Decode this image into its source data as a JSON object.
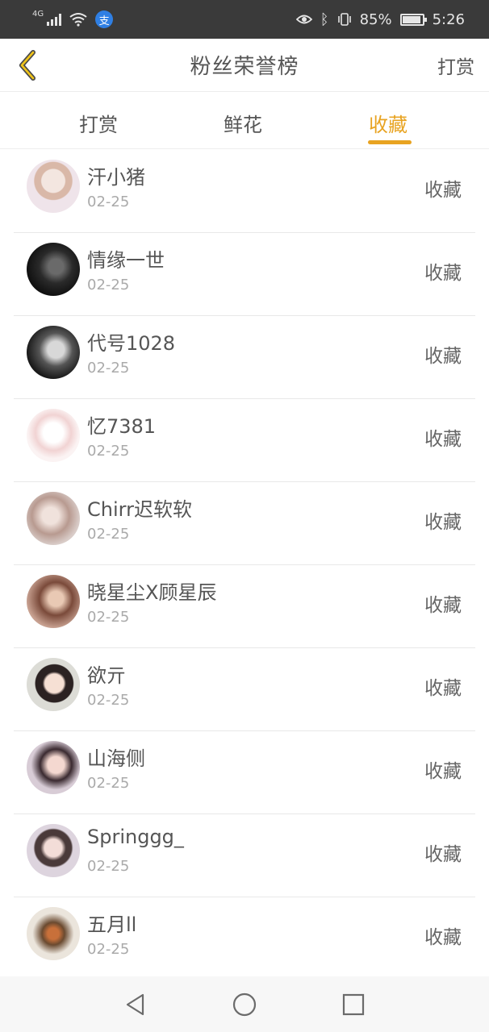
{
  "status_bar": {
    "network": "4G",
    "battery": "85%",
    "battery_level": 0.85,
    "time": "5:26",
    "pay_icon": "支"
  },
  "header": {
    "title": "粉丝荣誉榜",
    "action": "打赏",
    "back_icon": "chevron-left-icon",
    "accent_color": "#e8a321"
  },
  "tabs": [
    {
      "label": "打赏",
      "active": false
    },
    {
      "label": "鲜花",
      "active": false
    },
    {
      "label": "收藏",
      "active": true
    }
  ],
  "list": [
    {
      "name": "汗小猪",
      "date": "02-25",
      "action": "收藏"
    },
    {
      "name": "情缘一世",
      "date": "02-25",
      "action": "收藏"
    },
    {
      "name": "代号1028",
      "date": "02-25",
      "action": "收藏"
    },
    {
      "name": "忆7381",
      "date": "02-25",
      "action": "收藏"
    },
    {
      "name": "Chirr迟软软",
      "date": "02-25",
      "action": "收藏"
    },
    {
      "name": "晓星尘X顾星辰",
      "date": "02-25",
      "action": "收藏"
    },
    {
      "name": "欲亓",
      "date": "02-25",
      "action": "收藏"
    },
    {
      "name": "山海侧",
      "date": "02-25",
      "action": "收藏"
    },
    {
      "name": "Springgg_",
      "date": "02-25",
      "action": "收藏"
    },
    {
      "name": "五月ll",
      "date": "02-25",
      "action": "收藏"
    }
  ]
}
